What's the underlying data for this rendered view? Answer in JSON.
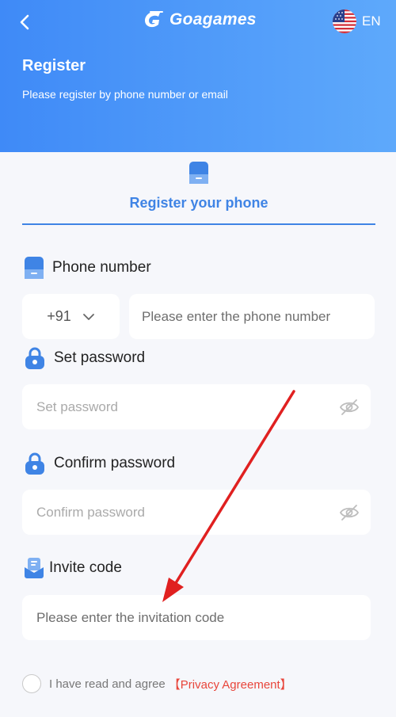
{
  "header": {
    "brand": "Goagames",
    "language": "EN",
    "title": "Register",
    "subtitle": "Please register by phone number or email"
  },
  "tab": {
    "label": "Register your phone"
  },
  "phone": {
    "label": "Phone number",
    "country_code": "+91",
    "placeholder": "Please enter the phone number"
  },
  "password": {
    "label": "Set password",
    "placeholder": "Set password"
  },
  "confirm_password": {
    "label": "Confirm password",
    "placeholder": "Confirm password"
  },
  "invite": {
    "label": "Invite code",
    "placeholder": "Please enter the invitation code"
  },
  "agreement": {
    "text": "I have read and agree",
    "link": "【Privacy Agreement】"
  },
  "colors": {
    "header_start": "#3f8af7",
    "header_end": "#5ea9fb",
    "accent": "#3f84e5",
    "link": "#e8463b",
    "annotation_arrow": "#e02020"
  },
  "icons": {
    "back": "chevron-left-icon",
    "logo": "goagames-logo-icon",
    "flag": "us-flag-icon",
    "tab": "phone-icon",
    "phone": "phone-icon",
    "password": "lock-icon",
    "confirm_password": "lock-icon",
    "invite": "invite-icon",
    "eye": "eye-slash-icon",
    "dropdown": "chevron-down-icon"
  }
}
